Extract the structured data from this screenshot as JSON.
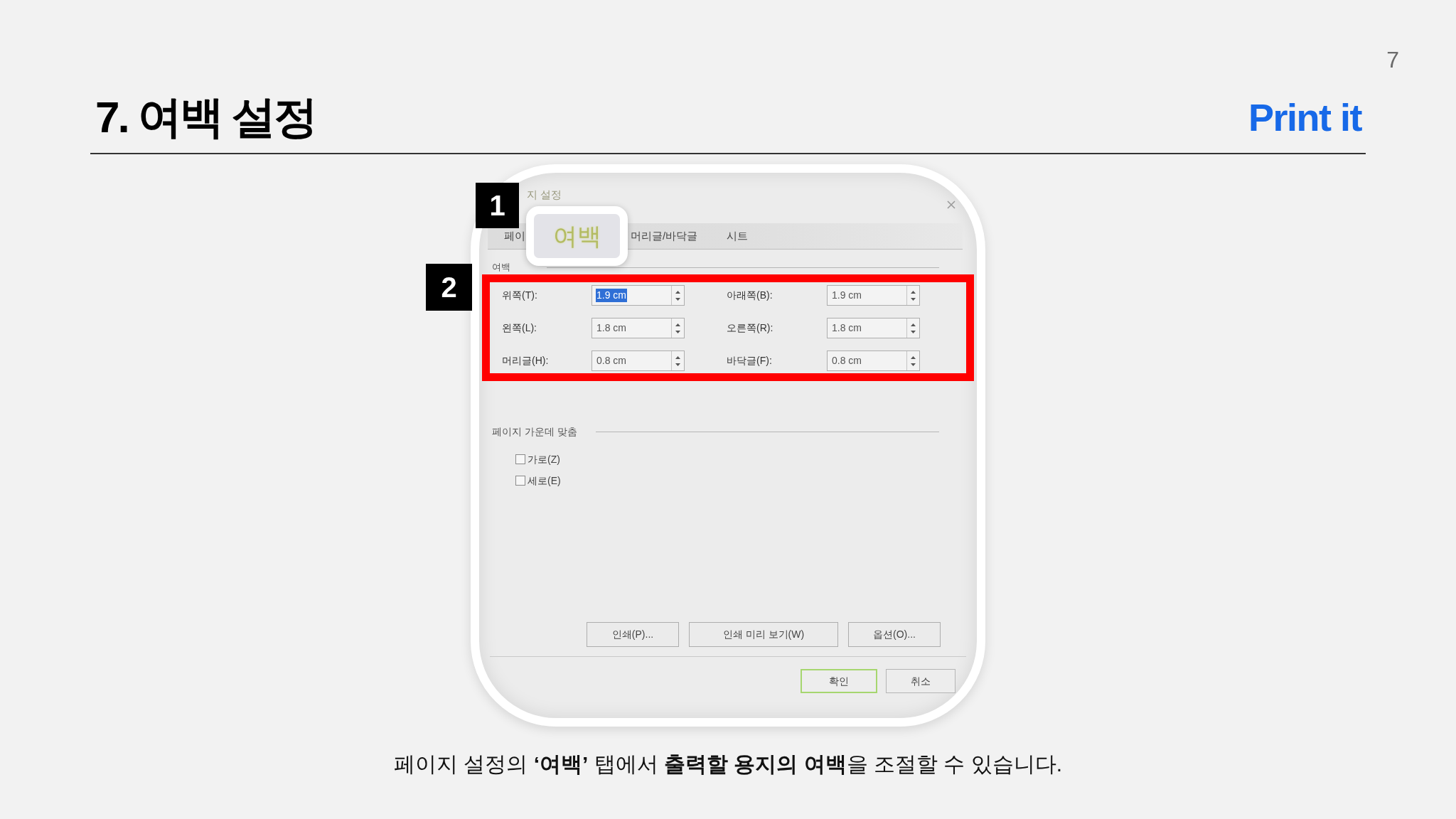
{
  "page_number": "7",
  "title": "7. 여백 설정",
  "brand": "Print it",
  "markers": [
    {
      "label": "1"
    },
    {
      "label": "2"
    }
  ],
  "dialog": {
    "title": "지 설정",
    "tabs": [
      {
        "label": "페이",
        "selected": false
      },
      {
        "label": "여백",
        "selected": true
      },
      {
        "label": "머리글/바닥글",
        "selected": false
      },
      {
        "label": "시트",
        "selected": false
      }
    ],
    "margins": {
      "label": "여백",
      "fields": [
        {
          "label": "위쪽(T):",
          "value": "1.9 cm",
          "selected": true
        },
        {
          "label": "아래쪽(B):",
          "value": "1.9 cm",
          "selected": false
        },
        {
          "label": "왼쪽(L):",
          "value": "1.8 cm",
          "selected": false
        },
        {
          "label": "오른쪽(R):",
          "value": "1.8 cm",
          "selected": false
        },
        {
          "label": "머리글(H):",
          "value": "0.8 cm",
          "selected": false
        },
        {
          "label": "바닥글(F):",
          "value": "0.8 cm",
          "selected": false
        }
      ]
    },
    "center": {
      "label": "페이지 가운데 맞춤",
      "options": [
        {
          "label": "가로(Z)",
          "checked": false
        },
        {
          "label": "세로(E)",
          "checked": false
        }
      ]
    },
    "action_buttons": [
      "인쇄(P)...",
      "인쇄 미리 보기(W)",
      "옵션(O)..."
    ],
    "footer_buttons": [
      {
        "label": "확인",
        "default": true
      },
      {
        "label": "취소",
        "default": false
      }
    ]
  },
  "caption": "페이지 설정의 **‘여백’** 탭에서 **출력할 용지의 여백**을 조절할 수 있습니다."
}
